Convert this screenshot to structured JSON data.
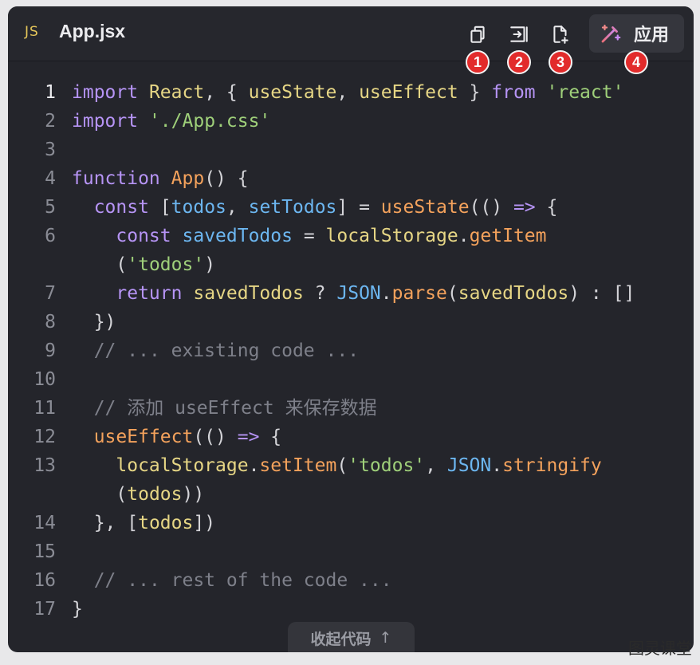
{
  "header": {
    "lang_badge": "JS",
    "filename": "App.jsx",
    "apply_label": "应用",
    "icons": [
      "copy-icon",
      "insert-at-cursor-icon",
      "new-file-icon",
      "magic-wand-icon"
    ],
    "badges": [
      "1",
      "2",
      "3",
      "4"
    ]
  },
  "code": {
    "line_numbers": [
      "1",
      "2",
      "3",
      "4",
      "5",
      "6",
      "",
      "7",
      "8",
      "9",
      "10",
      "11",
      "12",
      "13",
      "",
      "14",
      "15",
      "16",
      "17"
    ],
    "comment_1": "// ... existing code ...",
    "comment_2": "// 添加 useEffect 来保存数据",
    "comment_3": "// ... rest of the code ..."
  },
  "footer": {
    "collapse_label": "收起代码",
    "collapse_arrow": "↑"
  },
  "watermark": "图灵课堂",
  "colors": {
    "background": "#24252b",
    "keyword": "#b694f5",
    "function": "#f4a25c",
    "variable": "#e6d685",
    "string": "#9fd07a",
    "property": "#6cb6f0",
    "comment": "#7e808a",
    "badge": "#e22b2b"
  }
}
